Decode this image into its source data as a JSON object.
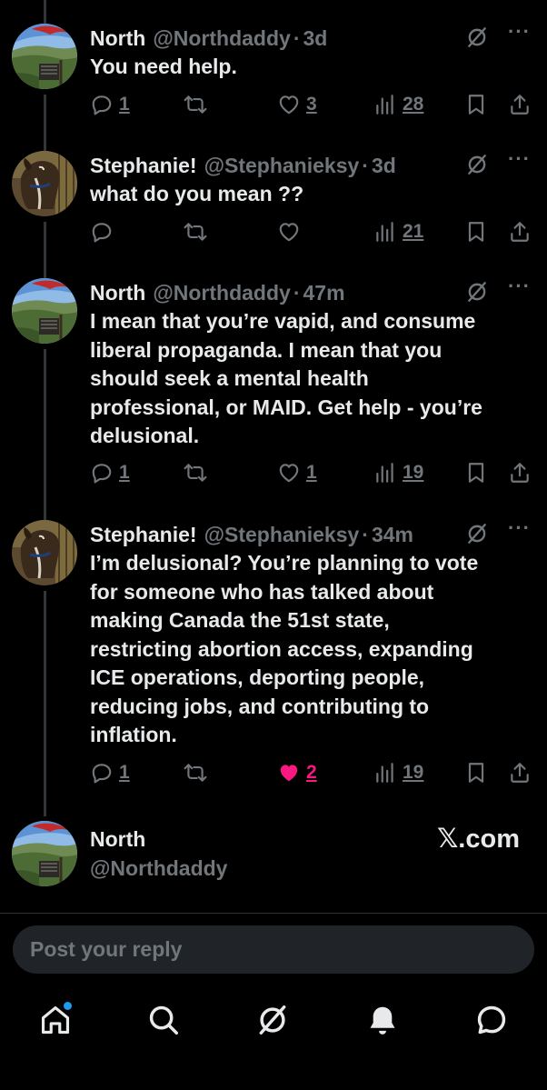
{
  "tweets": [
    {
      "name": "North",
      "handle": "@Northdaddy",
      "sep": "·",
      "time": "3d",
      "text": "You need help.",
      "reply_count": "1",
      "retweet_count": "",
      "like_count": "3",
      "views": "28",
      "liked": false,
      "avatar": "landscape-avatar"
    },
    {
      "name": "Stephanie!",
      "handle": "@Stephanieksy",
      "sep": "·",
      "time": "3d",
      "text": "what do you mean ??",
      "reply_count": "",
      "retweet_count": "",
      "like_count": "",
      "views": "21",
      "liked": false,
      "avatar": "horse-avatar"
    },
    {
      "name": "North",
      "handle": "@Northdaddy",
      "sep": "·",
      "time": "47m",
      "text_lines": [
        "I mean that you’re vapid, and consume",
        "liberal propaganda.  I mean that you",
        "should seek a mental health",
        "professional, or MAID.  Get help - you’re",
        "delusional."
      ],
      "reply_count": "1",
      "retweet_count": "",
      "like_count": "1",
      "views": "19",
      "liked": false,
      "avatar": "landscape-avatar"
    },
    {
      "name": "Stephanie!",
      "handle": "@Stephanieksy",
      "sep": "·",
      "time": "34m",
      "text_lines": [
        "I’m delusional? You’re planning to vote",
        "for someone who has talked about",
        "making Canada the 51st state,",
        "restricting abortion access, expanding",
        "ICE operations, deporting people,",
        "reducing jobs, and contributing to",
        "inflation."
      ],
      "reply_count": "1",
      "retweet_count": "",
      "like_count": "2",
      "views": "19",
      "liked": true,
      "avatar": "horse-avatar"
    }
  ],
  "composer_user": {
    "name": "North",
    "handle": "@Northdaddy"
  },
  "watermark": "𝕏.com",
  "reply_placeholder": "Post your reply",
  "nav": [
    "home-icon",
    "search-icon",
    "grok-icon",
    "notifications-icon",
    "messages-icon"
  ],
  "colors": {
    "background": "#000000",
    "text": "#e7e9ea",
    "muted": "#71767b",
    "like": "#f91880",
    "accent": "#1d9bf0"
  }
}
